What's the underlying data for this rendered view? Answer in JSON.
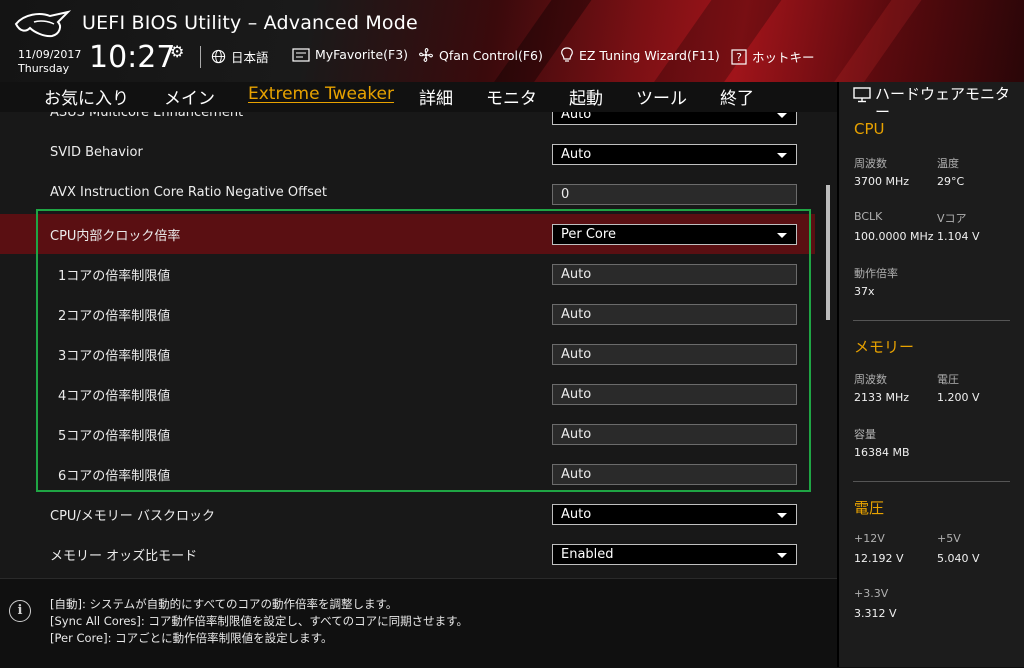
{
  "header": {
    "title": "UEFI BIOS Utility – Advanced Mode",
    "date": "11/09/2017",
    "day": "Thursday",
    "time": "10:27",
    "items": {
      "language": "日本語",
      "myfavorite": "MyFavorite(F3)",
      "qfan": "Qfan Control(F6)",
      "ez_tuning": "EZ Tuning Wizard(F11)",
      "hotkeys": "ホットキー"
    }
  },
  "tabs": [
    "お気に入り",
    "メイン",
    "Extreme Tweaker",
    "詳細",
    "モニタ",
    "起動",
    "ツール",
    "終了"
  ],
  "active_tab": "Extreme Tweaker",
  "settings": [
    {
      "label": "ASUS Multicore Enhancement",
      "value": "Auto",
      "type": "dropdown"
    },
    {
      "label": "SVID Behavior",
      "value": "Auto",
      "type": "dropdown"
    },
    {
      "label": "AVX Instruction Core Ratio Negative Offset",
      "value": "0",
      "type": "text"
    },
    {
      "label": "CPU内部クロック倍率",
      "value": "Per Core",
      "type": "dropdown"
    },
    {
      "label": "1コアの倍率制限値",
      "value": "Auto",
      "type": "text"
    },
    {
      "label": "2コアの倍率制限値",
      "value": "Auto",
      "type": "text"
    },
    {
      "label": "3コアの倍率制限値",
      "value": "Auto",
      "type": "text"
    },
    {
      "label": "4コアの倍率制限値",
      "value": "Auto",
      "type": "text"
    },
    {
      "label": "5コアの倍率制限値",
      "value": "Auto",
      "type": "text"
    },
    {
      "label": "6コアの倍率制限値",
      "value": "Auto",
      "type": "text"
    },
    {
      "label": "CPU/メモリー バスクロック",
      "value": "Auto",
      "type": "dropdown"
    },
    {
      "label": "メモリー オッズ比モード",
      "value": "Enabled",
      "type": "dropdown"
    }
  ],
  "info": {
    "lines": [
      "[自動]: システムが自動的にすべてのコアの動作倍率を調整します。",
      "[Sync All Cores]: コア動作倍率制限値を設定し、すべてのコアに同期させます。",
      "[Per Core]: コアごとに動作倍率制限値を設定します。"
    ]
  },
  "hw_monitor": {
    "title": "ハードウェアモニター",
    "cpu": {
      "heading": "CPU",
      "freq_label": "周波数",
      "freq": "3700 MHz",
      "temp_label": "温度",
      "temp": "29°C",
      "bclk_label": "BCLK",
      "bclk": "100.0000 MHz",
      "vcore_label": "Vコア",
      "vcore": "1.104 V",
      "ratio_label": "動作倍率",
      "ratio": "37x"
    },
    "memory": {
      "heading": "メモリー",
      "freq_label": "周波数",
      "freq": "2133 MHz",
      "volt_label": "電圧",
      "volt": "1.200 V",
      "cap_label": "容量",
      "cap": "16384 MB"
    },
    "voltage": {
      "heading": "電圧",
      "v12_label": "+12V",
      "v12": "12.192 V",
      "v5_label": "+5V",
      "v5": "5.040 V",
      "v33_label": "+3.3V",
      "v33": "3.312 V"
    }
  }
}
